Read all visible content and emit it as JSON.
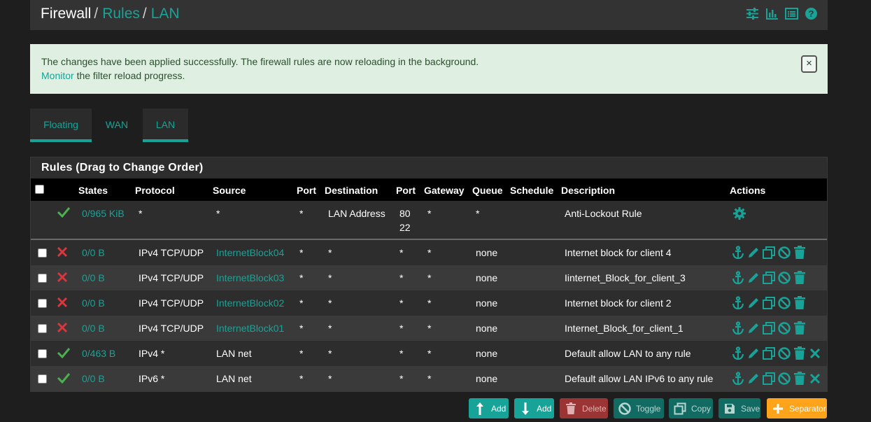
{
  "breadcrumb": {
    "root": "Firewall",
    "sep1": "/",
    "rules": "Rules",
    "sep2": "/",
    "current": "LAN"
  },
  "title_icons": [
    "sliders-icon",
    "chart-icon",
    "list-icon",
    "help-icon"
  ],
  "alert": {
    "line1": "The changes have been applied successfully. The firewall rules are now reloading in the background.",
    "link": "Monitor",
    "line2_rest": " the filter reload progress.",
    "close": "×"
  },
  "tabs": [
    {
      "label": "Floating",
      "active": false
    },
    {
      "label": "WAN",
      "active": false
    },
    {
      "label": "LAN",
      "active": true
    }
  ],
  "panel_title": "Rules (Drag to Change Order)",
  "columns": {
    "states": "States",
    "protocol": "Protocol",
    "source": "Source",
    "port": "Port",
    "destination": "Destination",
    "dport": "Port",
    "gateway": "Gateway",
    "queue": "Queue",
    "schedule": "Schedule",
    "description": "Description",
    "actions": "Actions"
  },
  "rules": [
    {
      "enabled": true,
      "states": "0/965 KiB",
      "protocol": "*",
      "source": "*",
      "port": "*",
      "destination": "LAN Address",
      "dport": "80",
      "dport2": "22",
      "gateway": "*",
      "queue": "*",
      "description": "Anti-Lockout Rule"
    },
    {
      "enabled": false,
      "states": "0/0 B",
      "protocol": "IPv4 TCP/UDP",
      "source": "InternetBlock04",
      "port": "*",
      "destination": "*",
      "dport": "*",
      "gateway": "*",
      "queue": "none",
      "description": "Internet block for client 4"
    },
    {
      "enabled": false,
      "states": "0/0 B",
      "protocol": "IPv4 TCP/UDP",
      "source": "InternetBlock03",
      "port": "*",
      "destination": "*",
      "dport": "*",
      "gateway": "*",
      "queue": "none",
      "description": "Iinternet_Block_for_client_3"
    },
    {
      "enabled": false,
      "states": "0/0 B",
      "protocol": "IPv4 TCP/UDP",
      "source": "InternetBlock02",
      "port": "*",
      "destination": "*",
      "dport": "*",
      "gateway": "*",
      "queue": "none",
      "description": "Internet block for client 2"
    },
    {
      "enabled": false,
      "states": "0/0 B",
      "protocol": "IPv4 TCP/UDP",
      "source": "InternetBlock01",
      "port": "*",
      "destination": "*",
      "dport": "*",
      "gateway": "*",
      "queue": "none",
      "description": "Internet_Block_for_client_1"
    },
    {
      "enabled": true,
      "states": "0/463 B",
      "protocol": "IPv4 *",
      "source": "LAN net",
      "port": "*",
      "destination": "*",
      "dport": "*",
      "gateway": "*",
      "queue": "none",
      "description": "Default allow LAN to any rule"
    },
    {
      "enabled": true,
      "states": "0/0 B",
      "protocol": "IPv6 *",
      "source": "LAN net",
      "port": "*",
      "destination": "*",
      "dport": "*",
      "gateway": "*",
      "queue": "none",
      "description": "Default allow LAN IPv6 to any rule"
    }
  ],
  "buttons": {
    "add_top": "Add",
    "add_bottom": "Add",
    "delete": "Delete",
    "toggle": "Toggle",
    "copy": "Copy",
    "save": "Save",
    "separator": "Separator"
  },
  "colors": {
    "accent": "#17a397",
    "pass": "#4caf50",
    "block": "#d9363e",
    "delete_btn": "#9b3535",
    "separator_btn": "#ffa31a",
    "alert_bg": "#dff0e2"
  }
}
